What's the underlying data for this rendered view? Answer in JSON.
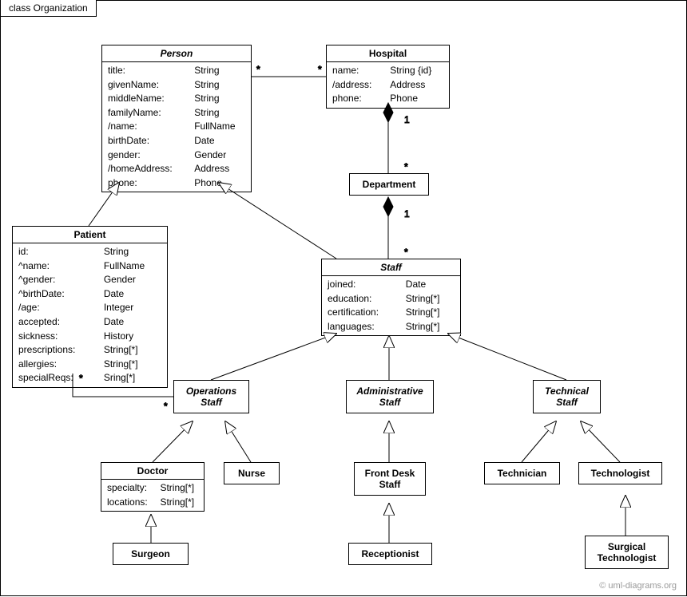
{
  "frame_label": "class Organization",
  "credit": "© uml-diagrams.org",
  "classes": {
    "person": {
      "name": "Person",
      "attrs": [
        {
          "n": "title:",
          "t": "String"
        },
        {
          "n": "givenName:",
          "t": "String"
        },
        {
          "n": "middleName:",
          "t": "String"
        },
        {
          "n": "familyName:",
          "t": "String"
        },
        {
          "n": "/name:",
          "t": "FullName"
        },
        {
          "n": "birthDate:",
          "t": "Date"
        },
        {
          "n": "gender:",
          "t": "Gender"
        },
        {
          "n": "/homeAddress:",
          "t": "Address"
        },
        {
          "n": "phone:",
          "t": "Phone"
        }
      ]
    },
    "hospital": {
      "name": "Hospital",
      "attrs": [
        {
          "n": "name:",
          "t": "String {id}"
        },
        {
          "n": "/address:",
          "t": "Address"
        },
        {
          "n": "phone:",
          "t": "Phone"
        }
      ]
    },
    "department": {
      "name": "Department"
    },
    "patient": {
      "name": "Patient",
      "attrs": [
        {
          "n": "id:",
          "t": "String"
        },
        {
          "n": "^name:",
          "t": "FullName"
        },
        {
          "n": "^gender:",
          "t": "Gender"
        },
        {
          "n": "^birthDate:",
          "t": "Date"
        },
        {
          "n": "/age:",
          "t": "Integer"
        },
        {
          "n": "accepted:",
          "t": "Date"
        },
        {
          "n": "sickness:",
          "t": "History"
        },
        {
          "n": "prescriptions:",
          "t": "String[*]"
        },
        {
          "n": "allergies:",
          "t": "String[*]"
        },
        {
          "n": "specialReqs:",
          "t": "Sring[*]"
        }
      ]
    },
    "staff": {
      "name": "Staff",
      "attrs": [
        {
          "n": "joined:",
          "t": "Date"
        },
        {
          "n": "education:",
          "t": "String[*]"
        },
        {
          "n": "certification:",
          "t": "String[*]"
        },
        {
          "n": "languages:",
          "t": "String[*]"
        }
      ]
    },
    "operations_staff": {
      "line1": "Operations",
      "line2": "Staff"
    },
    "admin_staff": {
      "line1": "Administrative",
      "line2": "Staff"
    },
    "technical_staff": {
      "line1": "Technical",
      "line2": "Staff"
    },
    "doctor": {
      "name": "Doctor",
      "attrs": [
        {
          "n": "specialty:",
          "t": "String[*]"
        },
        {
          "n": "locations:",
          "t": "String[*]"
        }
      ]
    },
    "nurse": {
      "name": "Nurse"
    },
    "front_desk": {
      "line1": "Front Desk",
      "line2": "Staff"
    },
    "technician": {
      "name": "Technician"
    },
    "technologist": {
      "name": "Technologist"
    },
    "surgeon": {
      "name": "Surgeon"
    },
    "receptionist": {
      "name": "Receptionist"
    },
    "surgical_tech": {
      "line1": "Surgical",
      "line2": "Technologist"
    }
  },
  "multiplicities": {
    "person_hospital_left": "*",
    "person_hospital_right": "*",
    "hospital_dept_top": "1",
    "hospital_dept_bot": "*",
    "dept_staff_top": "1",
    "dept_staff_bot": "*",
    "patient_ops_left": "*",
    "patient_ops_right": "*"
  }
}
